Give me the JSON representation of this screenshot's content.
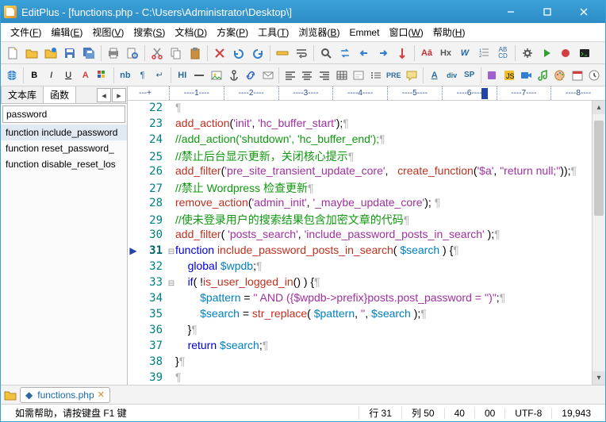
{
  "window": {
    "title": "EditPlus - [functions.php - C:\\Users\\Administrator\\Desktop\\]"
  },
  "menu": [
    {
      "label": "文件",
      "mnemonic": "F"
    },
    {
      "label": "编辑",
      "mnemonic": "E"
    },
    {
      "label": "视图",
      "mnemonic": "V"
    },
    {
      "label": "搜索",
      "mnemonic": "S"
    },
    {
      "label": "文档",
      "mnemonic": "D"
    },
    {
      "label": "方案",
      "mnemonic": "P"
    },
    {
      "label": "工具",
      "mnemonic": "T"
    },
    {
      "label": "浏览器",
      "mnemonic": "B"
    },
    {
      "label": "Emmet",
      "mnemonic": ""
    },
    {
      "label": "窗口",
      "mnemonic": "W"
    },
    {
      "label": "帮助",
      "mnemonic": "H"
    }
  ],
  "toolbar2_labels": {
    "nb": "nb",
    "hi": "HI",
    "aa": "Aā",
    "hx": "Hx",
    "w": "W",
    "abcd": "AB\nCD",
    "a_": "A",
    "div": "div",
    "sp": "SP",
    "pre": "PRE"
  },
  "sidebar": {
    "tabs": [
      "文本库",
      "函数"
    ],
    "filter_value": "password",
    "items": [
      "function include_password",
      "function reset_password_",
      "function disable_reset_los"
    ]
  },
  "ruler": {
    "max": 8,
    "caret_col": 5
  },
  "code": {
    "current_line": 31,
    "lines": [
      {
        "n": 22,
        "tokens": [
          [
            "nl",
            "¶"
          ]
        ]
      },
      {
        "n": 23,
        "tokens": [
          [
            "fn",
            "add_action"
          ],
          [
            "plain",
            "("
          ],
          [
            "str",
            "'init'"
          ],
          [
            "plain",
            ", "
          ],
          [
            "str",
            "'hc_buffer_start'"
          ],
          [
            "plain",
            ");"
          ],
          [
            "nl",
            "¶"
          ]
        ]
      },
      {
        "n": 24,
        "tokens": [
          [
            "cmt",
            "//add_action('shutdown', 'hc_buffer_end');"
          ],
          [
            "nl",
            "¶"
          ]
        ]
      },
      {
        "n": 25,
        "tokens": [
          [
            "cmt",
            "//禁止后台显示更新，关闭核心提示"
          ],
          [
            "nl",
            "¶"
          ]
        ]
      },
      {
        "n": 26,
        "tokens": [
          [
            "fn",
            "add_filter"
          ],
          [
            "plain",
            "("
          ],
          [
            "str",
            "'pre_site_transient_update_core'"
          ],
          [
            "plain",
            ",   "
          ],
          [
            "fn",
            "create_function"
          ],
          [
            "plain",
            "("
          ],
          [
            "str",
            "'$a'"
          ],
          [
            "plain",
            ", "
          ],
          [
            "str",
            "\"return null;\""
          ],
          [
            "plain",
            "));"
          ],
          [
            "nl",
            "¶"
          ]
        ]
      },
      {
        "n": 27,
        "tokens": [
          [
            "cmt",
            "//禁止 Wordpress 检查更新"
          ],
          [
            "nl",
            "¶"
          ]
        ]
      },
      {
        "n": 28,
        "tokens": [
          [
            "fn",
            "remove_action"
          ],
          [
            "plain",
            "("
          ],
          [
            "str",
            "'admin_init'"
          ],
          [
            "plain",
            ", "
          ],
          [
            "str",
            "'_maybe_update_core'"
          ],
          [
            "plain",
            "); "
          ],
          [
            "nl",
            "¶"
          ]
        ]
      },
      {
        "n": 29,
        "tokens": [
          [
            "cmt",
            "//使未登录用户的搜索结果包含加密文章的代码"
          ],
          [
            "nl",
            "¶"
          ]
        ]
      },
      {
        "n": 30,
        "tokens": [
          [
            "fn",
            "add_filter"
          ],
          [
            "plain",
            "( "
          ],
          [
            "str",
            "'posts_search'"
          ],
          [
            "plain",
            ", "
          ],
          [
            "str",
            "'include_password_posts_in_search'"
          ],
          [
            "plain",
            " );"
          ],
          [
            "nl",
            "¶"
          ]
        ]
      },
      {
        "n": 31,
        "mark": "▶",
        "fold": "⊟",
        "tokens": [
          [
            "kw",
            "function"
          ],
          [
            "plain",
            " "
          ],
          [
            "fn",
            "include_password_posts_in_search"
          ],
          [
            "plain",
            "( "
          ],
          [
            "var",
            "$search"
          ],
          [
            "plain",
            " ) {"
          ],
          [
            "nl",
            "¶"
          ]
        ]
      },
      {
        "n": 32,
        "indent": 1,
        "tokens": [
          [
            "kw",
            "global"
          ],
          [
            "plain",
            " "
          ],
          [
            "var",
            "$wpdb"
          ],
          [
            "plain",
            ";"
          ],
          [
            "nl",
            "¶"
          ]
        ]
      },
      {
        "n": 33,
        "indent": 1,
        "fold": "⊟",
        "tokens": [
          [
            "kw",
            "if"
          ],
          [
            "plain",
            "( !"
          ],
          [
            "fn",
            "is_user_logged_in"
          ],
          [
            "plain",
            "() ) {"
          ],
          [
            "nl",
            "¶"
          ]
        ]
      },
      {
        "n": 34,
        "indent": 2,
        "tokens": [
          [
            "var",
            "$pattern"
          ],
          [
            "plain",
            " = "
          ],
          [
            "str",
            "\" AND ({$wpdb->prefix}posts.post_password = '')\""
          ],
          [
            "plain",
            ";"
          ],
          [
            "nl",
            "¶"
          ]
        ]
      },
      {
        "n": 35,
        "indent": 2,
        "tokens": [
          [
            "var",
            "$search"
          ],
          [
            "plain",
            " = "
          ],
          [
            "fn",
            "str_replace"
          ],
          [
            "plain",
            "( "
          ],
          [
            "var",
            "$pattern"
          ],
          [
            "plain",
            ", "
          ],
          [
            "str",
            "''"
          ],
          [
            "plain",
            ", "
          ],
          [
            "var",
            "$search"
          ],
          [
            "plain",
            " );"
          ],
          [
            "nl",
            "¶"
          ]
        ]
      },
      {
        "n": 36,
        "indent": 1,
        "tokens": [
          [
            "plain",
            "}"
          ],
          [
            "nl",
            "¶"
          ]
        ]
      },
      {
        "n": 37,
        "indent": 1,
        "tokens": [
          [
            "kw",
            "return"
          ],
          [
            "plain",
            " "
          ],
          [
            "var",
            "$search"
          ],
          [
            "plain",
            ";"
          ],
          [
            "nl",
            "¶"
          ]
        ]
      },
      {
        "n": 38,
        "tokens": [
          [
            "plain",
            "}"
          ],
          [
            "nl",
            "¶"
          ]
        ]
      },
      {
        "n": 39,
        "tokens": [
          [
            "nl",
            "¶"
          ]
        ]
      }
    ]
  },
  "filetabs": {
    "file": "functions.php"
  },
  "status": {
    "help": "如需帮助，请按键盘 F1 键",
    "line": "行 31",
    "col": "列 50",
    "lines": "40",
    "mod": "00",
    "encoding": "UTF-8",
    "size": "19,943"
  }
}
